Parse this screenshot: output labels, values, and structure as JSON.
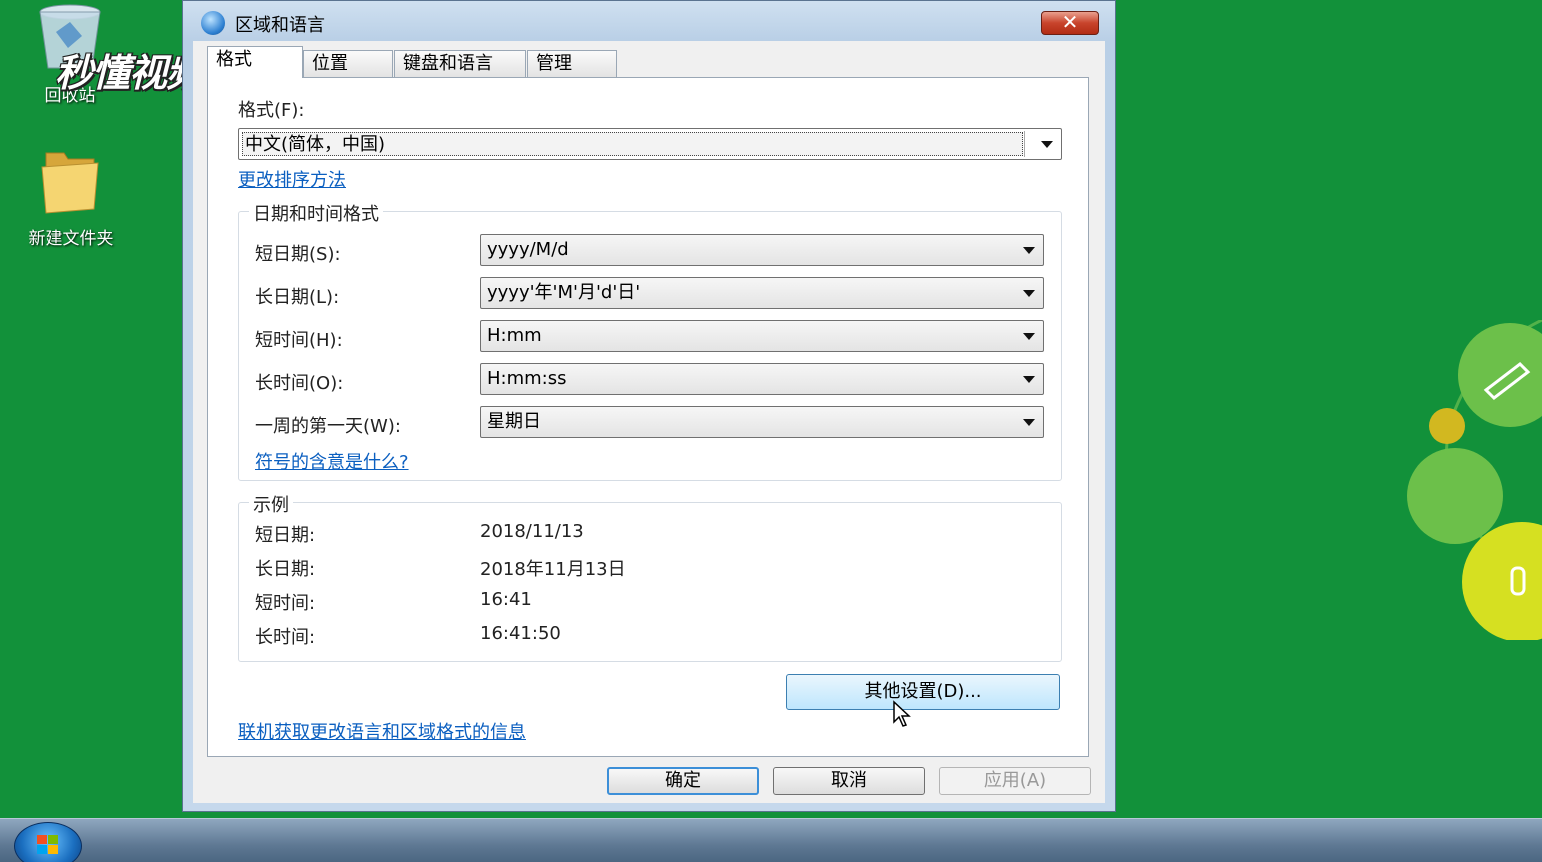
{
  "desktop": {
    "recycle_label": "回收站",
    "folder_label": "新建文件夹",
    "watermark": "秒懂视频"
  },
  "window": {
    "title": "区域和语言",
    "close_symbol": "✕",
    "tabs": [
      {
        "label": "格式"
      },
      {
        "label": "位置"
      },
      {
        "label": "键盘和语言"
      },
      {
        "label": "管理"
      }
    ],
    "format": {
      "label": "格式(F):",
      "value": "中文(简体，中国)",
      "sort_link": "更改排序方法"
    },
    "datetime_group": {
      "title": "日期和时间格式",
      "rows": [
        {
          "label": "短日期(S):",
          "value": "yyyy/M/d"
        },
        {
          "label": "长日期(L):",
          "value": "yyyy'年'M'月'd'日'"
        },
        {
          "label": "短时间(H):",
          "value": "H:mm"
        },
        {
          "label": "长时间(O):",
          "value": "H:mm:ss"
        },
        {
          "label": "一周的第一天(W):",
          "value": "星期日"
        }
      ],
      "symbols_link": "符号的含意是什么?"
    },
    "examples_group": {
      "title": "示例",
      "rows": [
        {
          "label": "短日期:",
          "value": "2018/11/13"
        },
        {
          "label": "长日期:",
          "value": "2018年11月13日"
        },
        {
          "label": "短时间:",
          "value": "16:41"
        },
        {
          "label": "长时间:",
          "value": "16:41:50"
        }
      ]
    },
    "more_settings_button": "其他设置(D)...",
    "online_link": "联机获取更改语言和区域格式的信息",
    "buttons": {
      "ok": "确定",
      "cancel": "取消",
      "apply": "应用(A)"
    }
  },
  "colors": {
    "desktop": "#12913a",
    "link": "#0b5fc0",
    "accent_green": "#8cc63f",
    "accent_yellow": "#d4e021"
  }
}
